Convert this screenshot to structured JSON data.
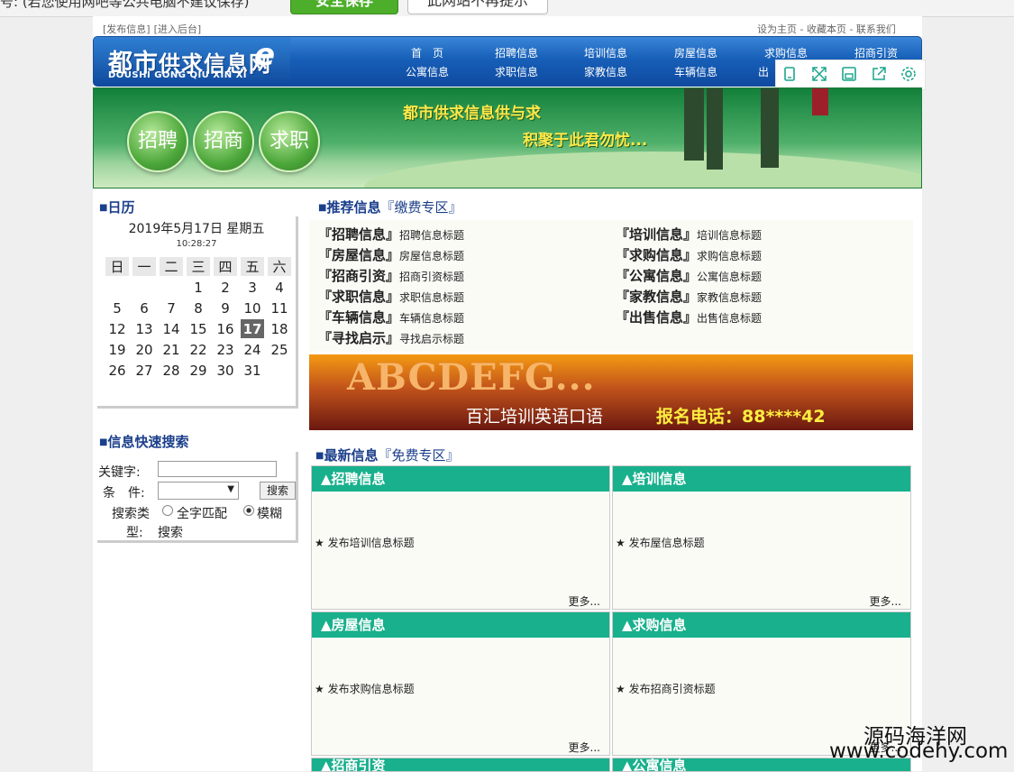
{
  "browser_bar": {
    "message": "号:     (若您使用网吧等公共电脑不建议保存)",
    "save_button": "安全保存",
    "no_prompt_button": "此网站不再提示"
  },
  "toplinks": {
    "left": [
      "[发布信息]",
      "[进入后台]"
    ],
    "right": "设为主页 - 收藏本页 - 联系我们"
  },
  "logo": {
    "cn_first": "都市",
    "cn_rest": "供求信息网",
    "en": "DOUSHI  GONG QIU XIN XI",
    "e": "e"
  },
  "nav": {
    "row1": [
      "首　页",
      "招聘信息",
      "培训信息",
      "房屋信息",
      "求购信息",
      "招商引资"
    ],
    "row2": [
      "公寓信息",
      "求职信息",
      "家教信息",
      "车辆信息",
      "出"
    ]
  },
  "tools": {
    "icons": [
      "phone-icon",
      "fullscreen-icon",
      "save-icon",
      "share-icon",
      "settings-icon"
    ]
  },
  "banner": {
    "bubbles": [
      "招聘",
      "招商",
      "求职"
    ],
    "slogan1": "都市供求信息供与求",
    "slogan2": "积聚于此君勿忧..."
  },
  "calendar": {
    "title": "日历",
    "date": "2019年5月17日 星期五",
    "time": "10:28:27",
    "weekdays": [
      "日",
      "一",
      "二",
      "三",
      "四",
      "五",
      "六"
    ],
    "rows": [
      [
        "",
        "",
        "",
        "1",
        "2",
        "3",
        "4"
      ],
      [
        "5",
        "6",
        "7",
        "8",
        "9",
        "10",
        "11"
      ],
      [
        "12",
        "13",
        "14",
        "15",
        "16",
        "17",
        "18"
      ],
      [
        "19",
        "20",
        "21",
        "22",
        "23",
        "24",
        "25"
      ],
      [
        "26",
        "27",
        "28",
        "29",
        "30",
        "31",
        ""
      ]
    ],
    "today": "17"
  },
  "search": {
    "title": "信息快速搜索",
    "keyword_label": "关键字:",
    "condition_label": "条　件:",
    "button": "搜索",
    "type_label_1": "搜索类",
    "type_label_2": "型:",
    "type_value": "搜索",
    "option_full": "全字匹配",
    "option_fuzzy": "模糊"
  },
  "recommended": {
    "title": "推荐信息",
    "subtitle": "『缴费专区』",
    "items": [
      {
        "cat": "『招聘信息』",
        "title": "招聘信息标题"
      },
      {
        "cat": "『培训信息』",
        "title": "培训信息标题"
      },
      {
        "cat": "『房屋信息』",
        "title": "房屋信息标题"
      },
      {
        "cat": "『求购信息』",
        "title": "求购信息标题"
      },
      {
        "cat": "『招商引资』",
        "title": "招商引资标题"
      },
      {
        "cat": "『公寓信息』",
        "title": "公寓信息标题"
      },
      {
        "cat": "『求职信息』",
        "title": "求职信息标题"
      },
      {
        "cat": "『家教信息』",
        "title": "家教信息标题"
      },
      {
        "cat": "『车辆信息』",
        "title": "车辆信息标题"
      },
      {
        "cat": "『出售信息』",
        "title": "出售信息标题"
      },
      {
        "cat": "『寻找启示』",
        "title": "寻找启示标题"
      }
    ]
  },
  "ad": {
    "big": "ABCDEFG...",
    "name": "百汇培训英语口语",
    "phone": "报名电话：88****42"
  },
  "latest": {
    "title": "最新信息",
    "subtitle": "『免费专区』",
    "more": "更多...",
    "panels": [
      {
        "header": "▲招聘信息",
        "item": "★ 发布培训信息标题"
      },
      {
        "header": "▲培训信息",
        "item": "★ 发布屋信息标题"
      },
      {
        "header": "▲房屋信息",
        "item": "★ 发布求购信息标题"
      },
      {
        "header": "▲求购信息",
        "item": "★ 发布招商引资标题"
      },
      {
        "header": "▲招商引资",
        "item": ""
      },
      {
        "header": "▲公寓信息",
        "item": ""
      }
    ]
  },
  "watermark": {
    "line1": "源码海洋网",
    "line2": "www.codehy.com"
  }
}
